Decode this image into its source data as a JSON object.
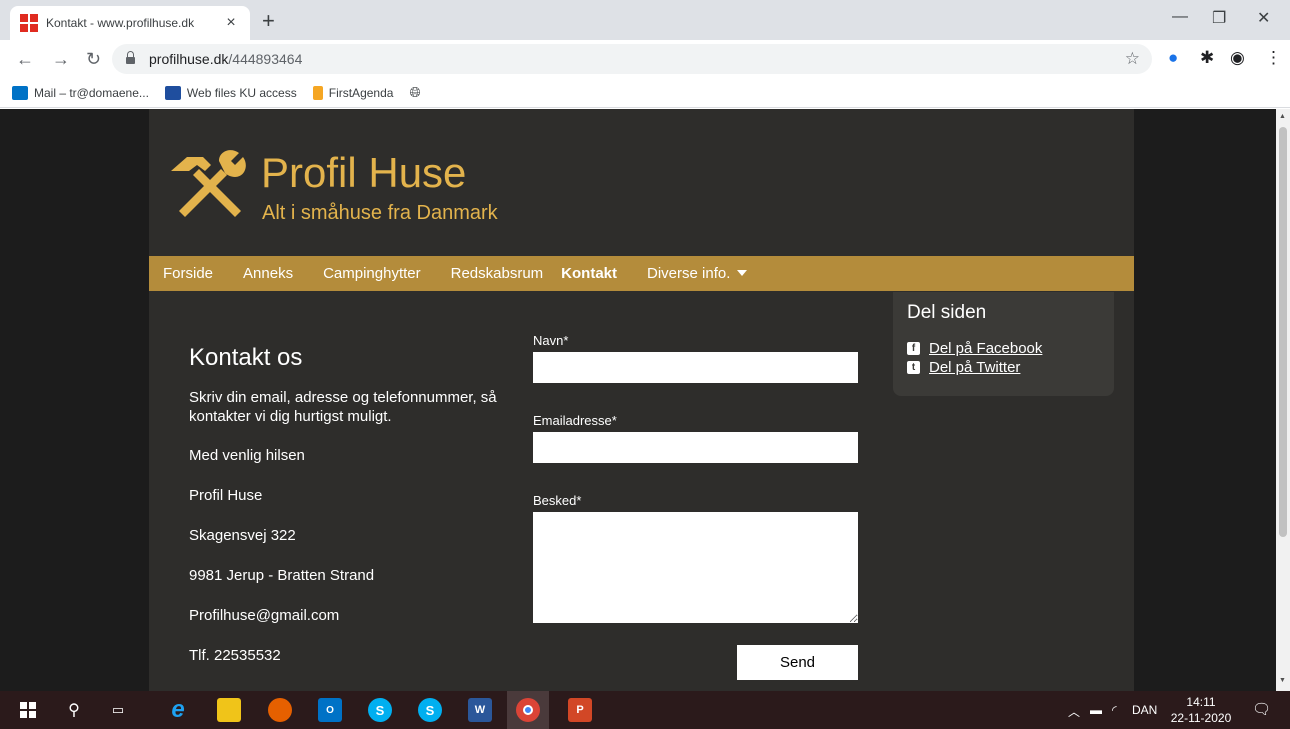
{
  "browser": {
    "tab_title": "Kontakt - www.profilhuse.dk",
    "tab_close": "×",
    "new_tab": "+",
    "url_domain": "profilhuse.dk",
    "url_path": "/444893464",
    "bookmarks": [
      {
        "label": "Mail – tr@domaene...",
        "color": "#0072c6"
      },
      {
        "label": "Web files KU access",
        "color": "#1f4e9e"
      },
      {
        "label": "FirstAgenda",
        "color": "#f5a623"
      },
      {
        "label": "",
        "color": "#5f6368"
      }
    ]
  },
  "site": {
    "brand": "Profil Huse",
    "tagline": "Alt i småhuse fra Danmark",
    "brand_color": "#e3b34c",
    "nav_color": "#b48c3b",
    "nav": [
      {
        "label": "Forside"
      },
      {
        "label": "Anneks"
      },
      {
        "label": "Campinghytter"
      },
      {
        "label": "Redskabsrum"
      },
      {
        "label": "Kontakt"
      },
      {
        "label": "Diverse info."
      }
    ],
    "contact": {
      "title": "Kontakt os",
      "intro": "Skriv din email, adresse og telefonnummer, så kontakter vi dig hurtigst muligt.",
      "greeting": "Med venlig hilsen",
      "company": "Profil Huse",
      "street": "Skagensvej 322",
      "city": "9981 Jerup - Bratten Strand",
      "email": "Profilhuse@gmail.com",
      "phone": "Tlf. 22535532"
    },
    "form": {
      "name_label": "Navn*",
      "email_label": "Emailadresse*",
      "message_label": "Besked*",
      "name_value": "",
      "email_value": "",
      "message_value": "",
      "send_label": "Send"
    },
    "share": {
      "title": "Del siden",
      "facebook": "Del på Facebook",
      "twitter": "Del på Twitter"
    }
  },
  "taskbar": {
    "language": "DAN",
    "time": "14:11",
    "date": "22-11-2020"
  }
}
